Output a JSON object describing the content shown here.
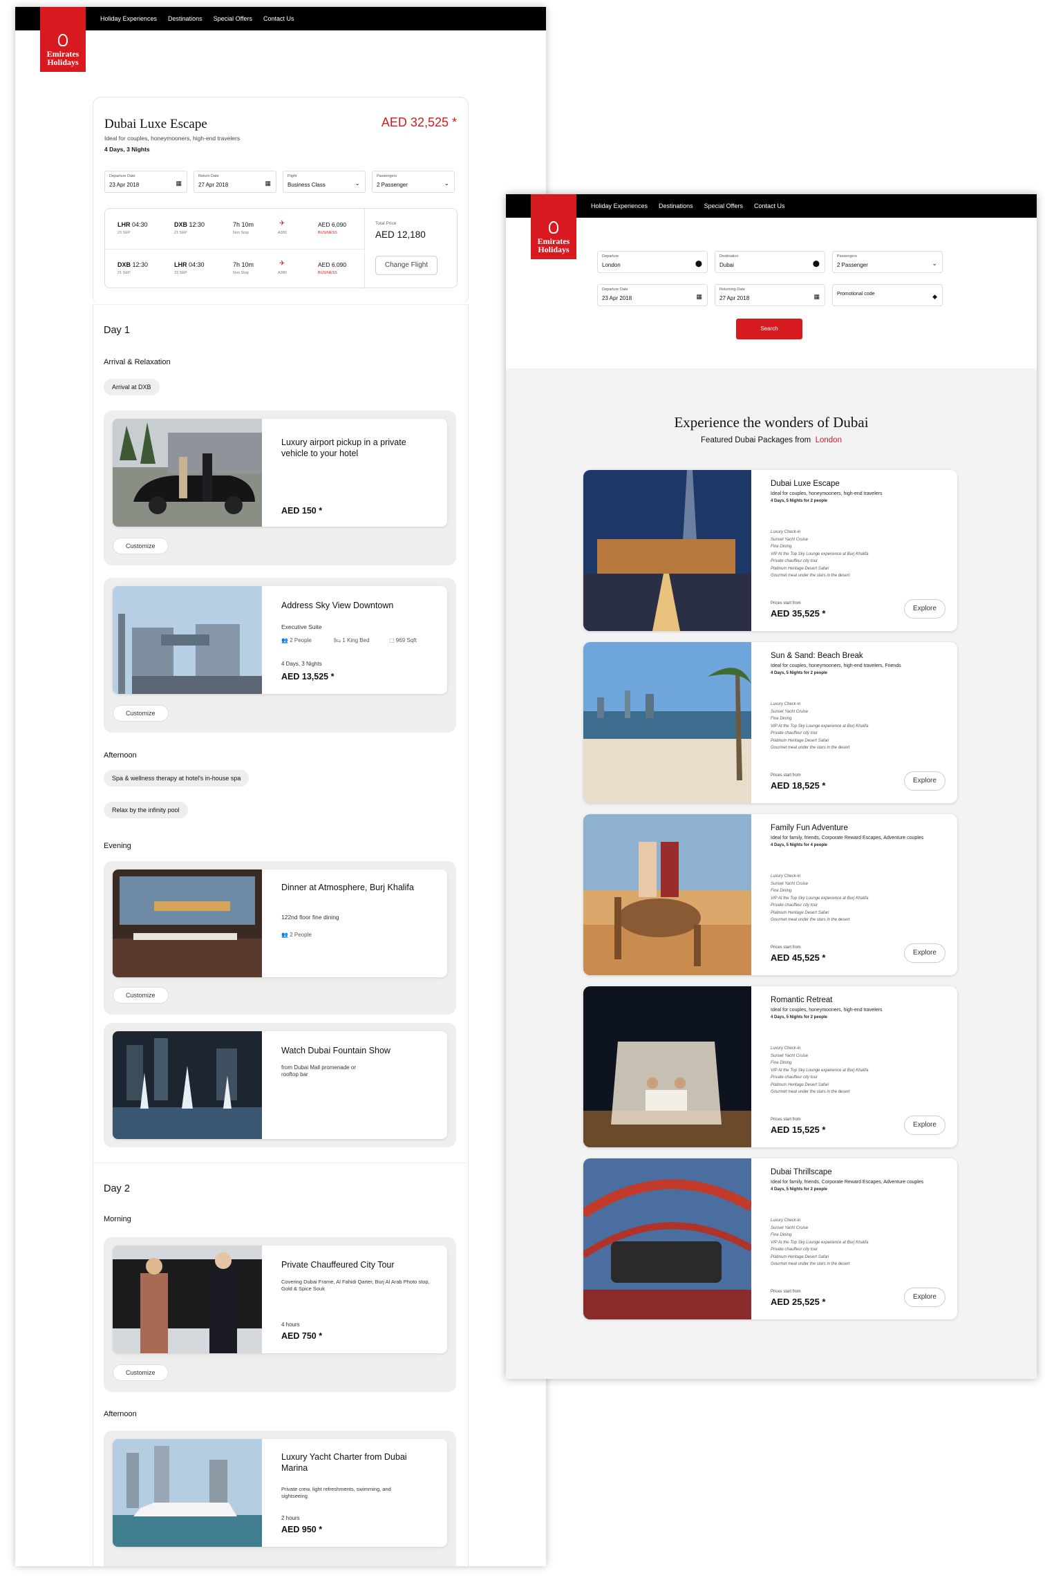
{
  "nav": [
    "Holiday Experiences",
    "Destinations",
    "Special Offers",
    "Contact Us"
  ],
  "logo": {
    "line1": "Emirates",
    "line2": "Holidays"
  },
  "colors": {
    "brand": "#d71920",
    "accent": "#d71920"
  },
  "package": {
    "title": "Dubai Luxe Escape",
    "subtitle": "Ideal for couples, honeymooners, high-end travelers",
    "duration": "4 Days, 3 Nights",
    "price": "AED 32,525 *"
  },
  "form1": {
    "departure": {
      "label": "Departure Date",
      "value": "23 Apr 2018"
    },
    "return": {
      "label": "Return Date",
      "value": "27 Apr 2018"
    },
    "flight": {
      "label": "Flight",
      "value": "Business Class"
    },
    "passengers": {
      "label": "Passengers",
      "value": "2 Passenger"
    }
  },
  "flights": [
    {
      "from": "LHR",
      "dep": "04:30",
      "ddate": "23 SEP",
      "to": "DXB",
      "arr": "12:30",
      "adate": "21 SEP",
      "dur": "7h 10m",
      "stops": "Non Stop",
      "plane": "A380",
      "price": "AED 6,090",
      "cls": "BUSINESS"
    },
    {
      "from": "DXB",
      "dep": "12:30",
      "ddate": "21 SEP",
      "to": "LHR",
      "arr": "04:30",
      "adate": "23 SEP",
      "dur": "7h 10m",
      "stops": "Non Stop",
      "plane": "A380",
      "price": "AED 6,090",
      "cls": "BUSINESS"
    }
  ],
  "total": {
    "label": "Total Price",
    "value": "AED 12,180",
    "button": "Change Flight"
  },
  "day1": {
    "title": "Day 1",
    "arrival": "Arrival & Relaxation",
    "arrival_pill": "Arrival at DXB",
    "pickup": {
      "title": "Luxury airport pickup in a private vehicle to your hotel",
      "price": "AED 150 *"
    },
    "hotel": {
      "title": "Address Sky View Downtown",
      "room": "Executive Suite",
      "people": "2 People",
      "bed": "1 King Bed",
      "size": "969 Sqft",
      "nights": "4 Days, 3 Nights",
      "price": "AED 13,525 *"
    },
    "afternoon": "Afternoon",
    "spa": "Spa & wellness therapy at hotel's in-house spa",
    "pool": "Relax by the infinity pool",
    "evening": "Evening",
    "dinner": {
      "title": "Dinner at Atmosphere, Burj Khalifa",
      "desc": "122nd floor fine dining",
      "people": "2 People"
    },
    "fountain": {
      "title": "Watch Dubai Fountain Show",
      "desc": "from Dubai Mall promenade or rooftop bar"
    }
  },
  "customize": "Customize",
  "day2": {
    "title": "Day 2",
    "morning": "Morning",
    "tour": {
      "title": "Private Chauffeured City Tour",
      "desc": "Covering Dubai Frame, Al Fahidi Qarter, Burj Al Arab Photo stop, Gold & Spice Souk",
      "hours": "4 hours",
      "price": "AED 750 *"
    },
    "afternoon": "Afternoon",
    "yacht": {
      "title": "Luxury Yacht Charter from Dubai Marina",
      "desc": "Private crew, light refreshments, swimming, and sightseeing",
      "hours": "2 hours",
      "price": "AED 950 *"
    }
  },
  "search": {
    "departure": {
      "label": "Departure",
      "value": "London"
    },
    "destination": {
      "label": "Destination",
      "value": "Dubai"
    },
    "passengers": {
      "label": "Passengers",
      "value": "2 Passenger"
    },
    "dep_date": {
      "label": "Departure Date",
      "value": "23 Apr 2018"
    },
    "ret_date": {
      "label": "Returning Date",
      "value": "27 Apr 2018"
    },
    "promo": {
      "label": "Promotional code"
    },
    "button": "Search"
  },
  "listing": {
    "title": "Experience the wonders of Dubai",
    "subtitle": "Featured Dubai Packages from",
    "city": "London"
  },
  "features": [
    "Luxury Check-in",
    "Sunset Yacht Cruise",
    "Fine Dining",
    "VIP At the Top Sky Lounge experience at Burj Khalifa",
    "Private chauffeur city tour",
    "Platinum Heritage Desert Safari",
    "Gourmet meal under the stars in the desert"
  ],
  "prices_from": "Prices start from",
  "explore": "Explore",
  "packages": [
    {
      "title": "Dubai Luxe Escape",
      "desc": "Ideal for couples, honeymooners, high-end travelers",
      "nights": "4 Days, 5 Nights for 2 people",
      "price": "AED 35,525 *"
    },
    {
      "title": "Sun & Sand: Beach Break",
      "desc": "Ideal for couples, honeymooners, high-end travelers, Friends",
      "nights": "4 Days, 5 Nights for 2 people",
      "price": "AED 18,525 *"
    },
    {
      "title": "Family Fun Adventure",
      "desc": "Ideal for family, friends, Corporate Reward Escapes, Adventure couples",
      "nights": "4 Days, 5 Nights for 4 people",
      "price": "AED 45,525 *"
    },
    {
      "title": "Romantic Retreat",
      "desc": "Ideal for couples, honeymooners, high-end travelers",
      "nights": "4 Days, 5 Nights for 2 people",
      "price": "AED 15,525 *"
    },
    {
      "title": "Dubai Thrillscape",
      "desc": "Ideal for family, friends, Corporate Reward Escapes, Adventure couples",
      "nights": "4 Days, 5 Nights for 2 people",
      "price": "AED 25,525 *"
    }
  ]
}
